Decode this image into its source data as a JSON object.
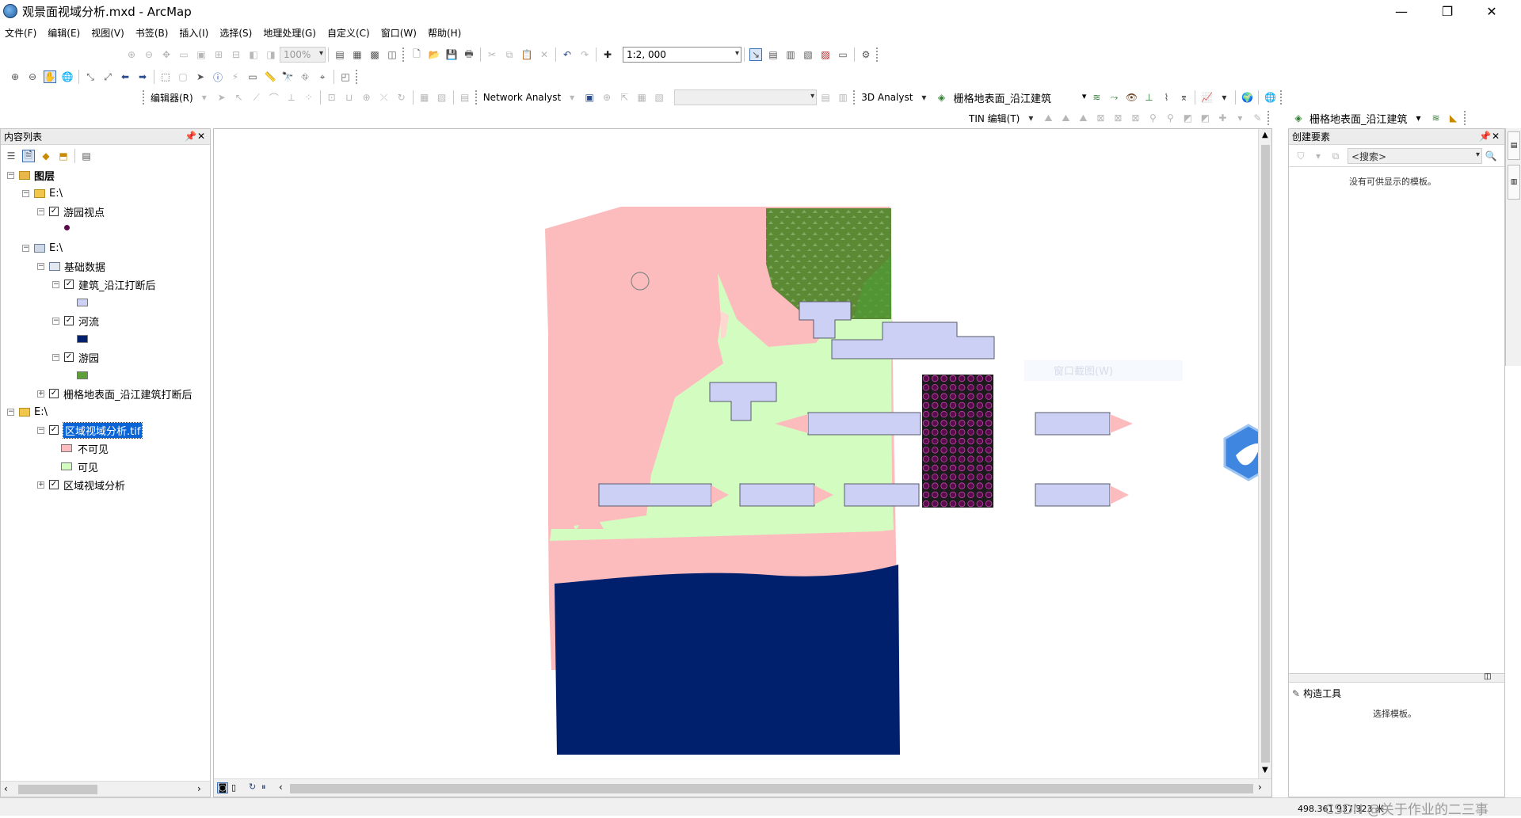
{
  "window": {
    "title": "观景面视域分析.mxd - ArcMap",
    "min_icon": "minimize-icon",
    "max_icon": "restore-icon",
    "close_icon": "close-icon"
  },
  "menu": [
    "文件(F)",
    "编辑(E)",
    "视图(V)",
    "书签(B)",
    "插入(I)",
    "选择(S)",
    "地理处理(G)",
    "自定义(C)",
    "窗口(W)",
    "帮助(H)"
  ],
  "toolbar": {
    "zoom_value": "100%",
    "scale_value": "1:2, 000",
    "editor_label": "编辑器(R)",
    "network_analyst": "Network Analyst",
    "analyst_3d": "3D Analyst",
    "raster_surface_layer": "栅格地表面_沿江建筑",
    "tin_editor": "TIN 编辑(T)",
    "right_layer": "栅格地表面_沿江建筑"
  },
  "toc": {
    "title": "内容列表",
    "root": "图层",
    "groups": [
      {
        "path": "E:\\",
        "layers": [
          {
            "name": "游园视点"
          }
        ]
      },
      {
        "path": "E:\\",
        "group": "基础数据",
        "layers": [
          {
            "name": "建筑_沿江打断后"
          },
          {
            "name": "河流"
          },
          {
            "name": "游园"
          }
        ]
      },
      {
        "layer": "栅格地表面_沿江建筑打断后"
      },
      {
        "path": "E:\\",
        "layers": [
          {
            "name": "区域视域分析.tif",
            "classes": [
              "不可见",
              "可见"
            ]
          },
          {
            "name": "区域视域分析"
          }
        ]
      }
    ]
  },
  "create_features": {
    "title": "创建要素",
    "search_placeholder": "<搜索>",
    "no_templates": "没有可供显示的模板。",
    "construct_tools": "构造工具",
    "select_template": "选择模板。"
  },
  "map": {
    "faded_overlay_text": "窗口截图(W)"
  },
  "status": {
    "coords": "498.361   937.323 米",
    "watermark": "CSDN @关于作业的二三事"
  },
  "colors": {
    "invisible": "#fcbcbe",
    "visible": "#d3fdc0",
    "building": "#cbd0f4",
    "river": "#00206e",
    "park": "#5e8b35",
    "viewpoint": "#5b0a4c"
  }
}
